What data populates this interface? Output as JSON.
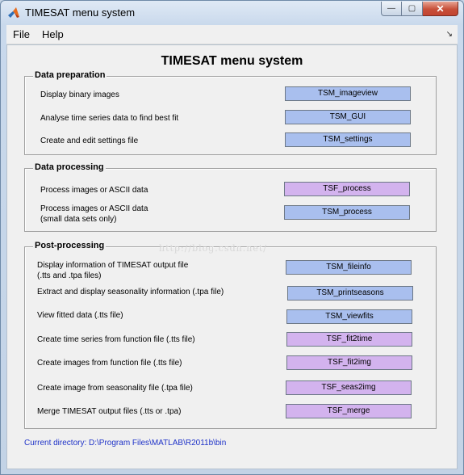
{
  "window": {
    "title": "TIMESAT menu system",
    "controls": {
      "min": "—",
      "max": "▢",
      "close": "✕"
    }
  },
  "menu": {
    "file": "File",
    "help": "Help",
    "corner_glyph": "↘"
  },
  "main_title": "TIMESAT menu system",
  "panels": {
    "data_prep": {
      "title": "Data preparation",
      "rows": [
        {
          "label": "Display binary images",
          "button": "TSM_imageview"
        },
        {
          "label": "Analyse time series data to find best fit",
          "button": "TSM_GUI"
        },
        {
          "label": "Create and edit settings file",
          "button": "TSM_settings"
        }
      ]
    },
    "data_proc": {
      "title": "Data processing",
      "rows": [
        {
          "label": "Process images or ASCII data",
          "button": "TSF_process"
        },
        {
          "label": "Process images or ASCII data",
          "label2": "(small data sets only)",
          "button": "TSM_process"
        }
      ]
    },
    "post_proc": {
      "title": "Post-processing",
      "rows": [
        {
          "label": "Display information of TIMESAT output file",
          "label2": "(.tts and .tpa files)",
          "button": "TSM_fileinfo"
        },
        {
          "label": "Extract and display seasonality information (.tpa file)",
          "button": "TSM_printseasons"
        },
        {
          "label": "View fitted data (.tts file)",
          "button": "TSM_viewfits"
        },
        {
          "label": "Create time series from function file (.tts file)",
          "button": "TSF_fit2time"
        },
        {
          "label": "Create images from function file (.tts file)",
          "button": "TSF_fit2img"
        },
        {
          "label": "Create image from seasonality file (.tpa file)",
          "button": "TSF_seas2img"
        },
        {
          "label": "Merge TIMESAT output files (.tts or .tpa)",
          "button": "TSF_merge"
        }
      ]
    }
  },
  "watermark": "http://blog.csdn.net/",
  "current_directory": "Current directory:  D:\\Program Files\\MATLAB\\R2011b\\bin",
  "colors": {
    "tsm_button": "#a9bfee",
    "tsf_button": "#d3b3ee",
    "directory_text": "#1f33c8"
  }
}
